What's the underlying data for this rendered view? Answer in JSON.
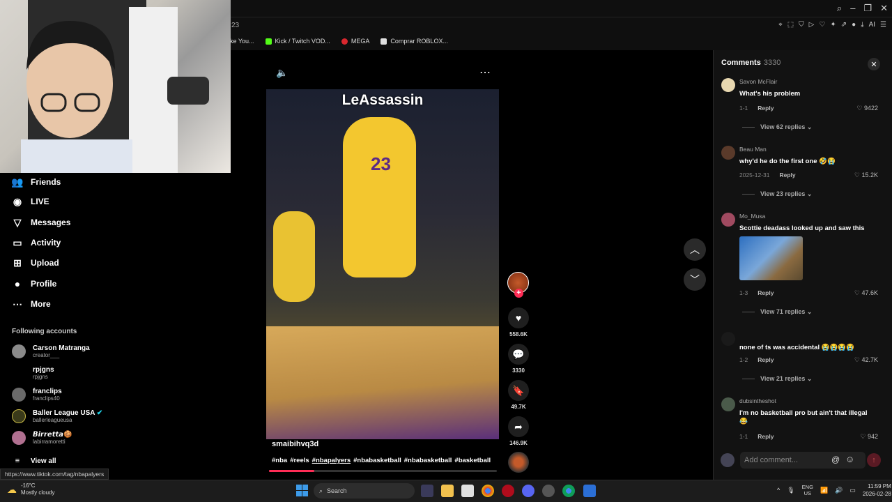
{
  "browser": {
    "tab_fragment": "23",
    "bookmarks": [
      {
        "label": "ke You...",
        "color": "#888888"
      },
      {
        "label": "Kick / Twitch VOD...",
        "color": "#53fc18"
      },
      {
        "label": "MEGA",
        "color": "#d9272e"
      },
      {
        "label": "Comprar ROBLOX...",
        "color": "#e0e0e0"
      }
    ],
    "ext_ai": "AI"
  },
  "sidebar": {
    "items": [
      {
        "label": "Friends",
        "icon": "friends-icon",
        "glyph": "👥"
      },
      {
        "label": "LIVE",
        "icon": "live-icon",
        "glyph": "◉"
      },
      {
        "label": "Messages",
        "icon": "messages-icon",
        "glyph": "▽"
      },
      {
        "label": "Activity",
        "icon": "activity-icon",
        "glyph": "▭"
      },
      {
        "label": "Upload",
        "icon": "upload-icon",
        "glyph": "⊞"
      },
      {
        "label": "Profile",
        "icon": "profile-icon",
        "glyph": "●"
      },
      {
        "label": "More",
        "icon": "more-icon",
        "glyph": "⋯"
      }
    ],
    "following_title": "Following accounts",
    "accounts": [
      {
        "name": "Carson Matranga",
        "handle": "creator___"
      },
      {
        "name": "rpjgns",
        "handle": "rpjgns"
      },
      {
        "name": "franclips",
        "handle": "franclips40"
      },
      {
        "name": "Baller League USA",
        "handle": "ballerleagueusa",
        "verified": true
      },
      {
        "name": "𝘽𝙞𝙧𝙧𝙚𝙩𝙩𝙖🍪",
        "handle": "labirramoretti"
      }
    ],
    "view_all": "View all"
  },
  "video": {
    "caption_overlay": "LeAssassin",
    "jersey_number": "23",
    "author": "smaibihvq3d",
    "hashtags": [
      "#nba",
      "#reels",
      "#nbapalyers",
      "#nbabasketball",
      "#nbabasketball",
      "#basketball"
    ],
    "active_tag_index": 2,
    "progress_fraction": 0.2,
    "likes": "558.6K",
    "comments": "3330",
    "saves": "49.7K",
    "shares": "146.9K"
  },
  "comments": {
    "title": "Comments",
    "count": "3330",
    "add_placeholder": "Add comment...",
    "reply_label": "Reply",
    "items": [
      {
        "user": "Savon McFlair",
        "text": "What's his problem",
        "date": "1-1",
        "likes": "9422",
        "replies": "View 62 replies"
      },
      {
        "user": "Beau Man",
        "text": "why'd he do the first one 🤣😭",
        "date": "2025-12-31",
        "likes": "15.2K",
        "replies": "View 23 replies"
      },
      {
        "user": "Mo_Musa",
        "text": "Scottie deadass looked up and saw this",
        "date": "1-3",
        "likes": "47.6K",
        "replies": "View 71 replies"
      },
      {
        "user": "",
        "text": "none of ts was accidental 😭😭😭😭",
        "date": "1-2",
        "likes": "42.7K",
        "replies": "View 21 replies"
      },
      {
        "user": "dubsintheshot",
        "text": "I'm no basketball pro but ain't that illegal 😂",
        "date": "1-1",
        "likes": "942",
        "replies": ""
      }
    ]
  },
  "status_url": "https://www.tiktok.com/tag/nbapalyers",
  "taskbar": {
    "temp": "-16°C",
    "weather": "Mostly cloudy",
    "search": "Search",
    "lang1": "ENG",
    "lang2": "US",
    "time": "11:59 PM",
    "date": "2026-02-28"
  }
}
